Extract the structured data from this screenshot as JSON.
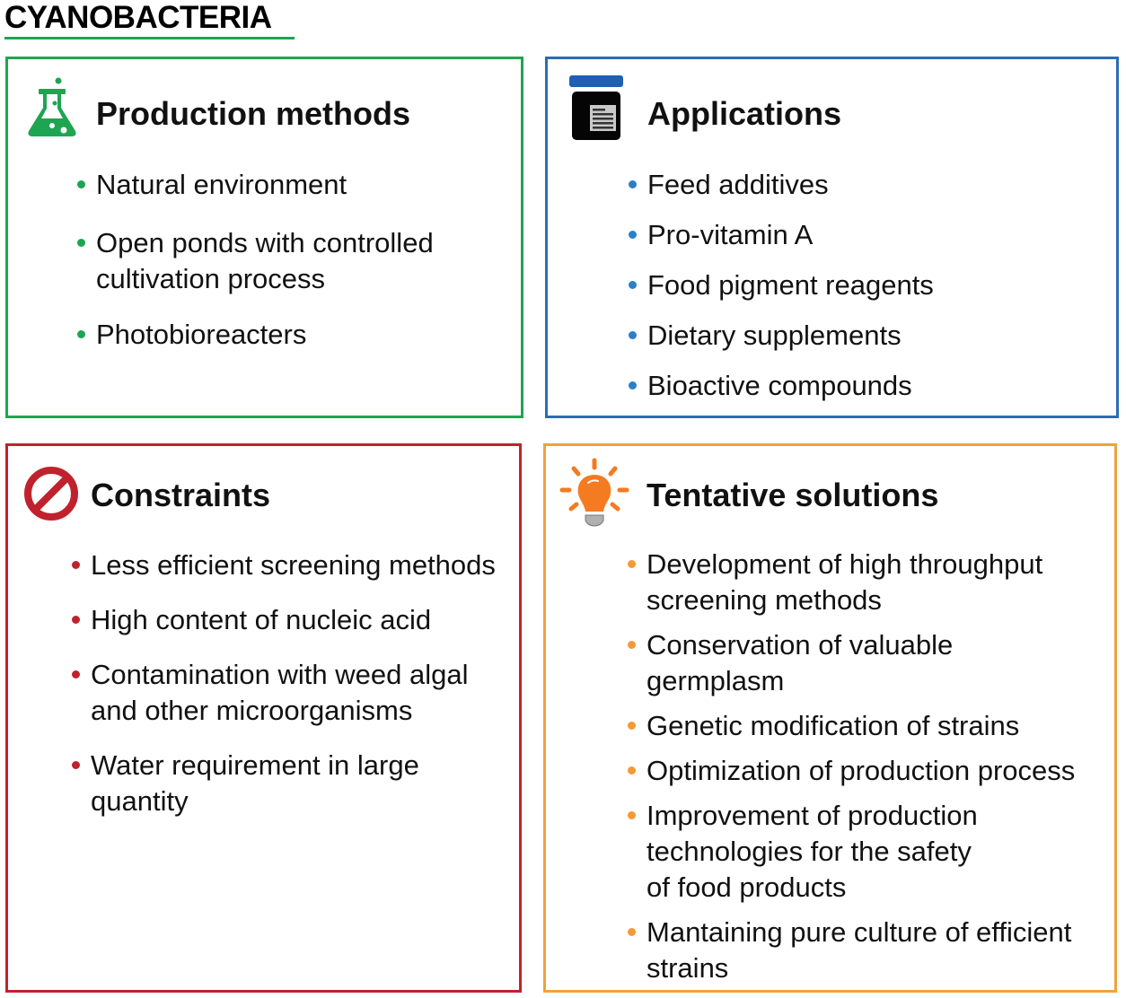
{
  "title": "CYANOBACTERIA",
  "colors": {
    "green": "#1ea551",
    "blue": "#2a6db5",
    "red": "#c0222d",
    "orange": "#f0a23a"
  },
  "panels": {
    "production": {
      "icon": "flask-icon",
      "heading": "Production methods",
      "items": [
        "Natural environment",
        "Open ponds with controlled\ncultivation process",
        "Photobioreacters"
      ]
    },
    "applications": {
      "icon": "jar-icon",
      "heading": "Applications",
      "items": [
        "Feed additives",
        "Pro-vitamin A",
        "Food pigment reagents",
        "Dietary supplements",
        "Bioactive compounds"
      ]
    },
    "constraints": {
      "icon": "prohibited-icon",
      "heading": "Constraints",
      "items": [
        "Less efficient screening methods",
        "High content of nucleic acid",
        "Contamination with weed algal\nand other microorganisms",
        "Water requirement in large\nquantity"
      ]
    },
    "solutions": {
      "icon": "lightbulb-icon",
      "heading": "Tentative solutions",
      "items": [
        "Development of high throughput\nscreening methods",
        "Conservation of valuable\ngermplasm",
        "Genetic modification of strains",
        "Optimization of production process",
        "Improvement of production\ntechnologies for the safety\nof food products",
        "Mantaining pure culture of efficient\nstrains"
      ]
    }
  }
}
